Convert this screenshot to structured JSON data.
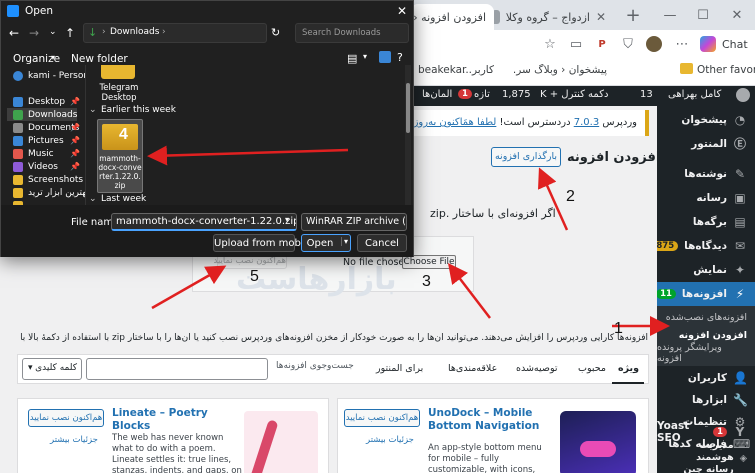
{
  "browser": {
    "tabs": [
      {
        "label": "افزودن افزونه ‹ ک"
      },
      {
        "label": "ازدواج – گروه وکلا"
      }
    ],
    "address_icons": [
      "star-icon",
      "reader-icon",
      "share-icon",
      "extension-icon",
      "wallet-icon",
      "favorites-icon",
      "copilot-icon"
    ],
    "chat_label": "Chat",
    "bookmarks": {
      "other_favorites": "Other favorites",
      "items": [
        "پیشخوان ‹ وبلاگ سر...",
        "کاربر...",
        "beakekar"
      ]
    }
  },
  "adminbar": {
    "site": "کامل بهراهی",
    "updates": "13",
    "dashboard_control": "دکمه کنترل + K",
    "comments": "1,875",
    "new": "تازه",
    "new_count": "1",
    "elementor": "المان‌ها"
  },
  "sidebar": {
    "items": [
      {
        "label": "پیشخوان",
        "icon": "dashboard-icon"
      },
      {
        "label": "المنتور",
        "icon": "elementor-icon"
      },
      {
        "label": "نوشته‌ها",
        "icon": "posts-icon"
      },
      {
        "label": "رسانه",
        "icon": "media-icon"
      },
      {
        "label": "برگه‌ها",
        "icon": "pages-icon"
      },
      {
        "label": "دیدگاه‌ها",
        "icon": "comments-icon",
        "badge": "1,875"
      },
      {
        "label": "نمایش",
        "icon": "appearance-icon"
      },
      {
        "label": "افزونه‌ها",
        "icon": "plugins-icon",
        "badge": "11"
      },
      {
        "label": "افزونه‌های نصب‌شده"
      },
      {
        "label": "افزودن افزونه"
      },
      {
        "label": "ویرایشگر پرونده افزونه"
      },
      {
        "label": "کاربران",
        "icon": "users-icon"
      },
      {
        "label": "ابزارها",
        "icon": "tools-icon"
      },
      {
        "label": "تنظیمات",
        "icon": "settings-icon"
      },
      {
        "label": "فاصله کدها",
        "icon": "snippets-icon"
      },
      {
        "label": "Yoast SEO",
        "icon": "yoast-icon",
        "badge": "1"
      },
      {
        "label": "مدیریت هوشمند رسانه چین",
        "icon": "smart-icon"
      }
    ]
  },
  "main": {
    "notice_prefix": "وردپرس",
    "notice_version": "7.0.3",
    "notice_mid": " دردسترس است! ",
    "notice_link": "لطفا همَاکنون به‌روزرسانی نمایید.",
    "page_title": "افزودن افزونه",
    "upload_button": "بارگذاری افزونه",
    "upload_hint": "اگر افزونه‌ای با ساختار .zip",
    "no_file": "No file chosen",
    "choose_file": "Choose File",
    "install_now": "هم‌اکنون نصب نمایید",
    "watermark": "بازارهاست",
    "description": "افزونه‌ها کارایی وردپرس را افزایش می‌دهند. می‌توانید آن‌ها را به صورت خودکار از مخزن افزونه‌های وردپرس نصب کنید یا آن‌ها را با ساختار zip با استفاده از دکمهٔ بالا بارگذاری کنید.",
    "description_link": "مخزن افزونه‌های وردپرس",
    "filter_tabs": [
      "ویژه",
      "محبوب",
      "توصیه‌شده",
      "علاقه‌مندی‌ها"
    ],
    "for_elementor": "برای المنتور",
    "search_type": "کلمه کلیدی",
    "search_placeholder": "جست‌وجوی افزونه‌ها",
    "cards": [
      {
        "title": "UnoDock – Mobile Bottom Navigation",
        "install": "هم‌اکنون نصب نمایید",
        "details": "جزئیات بیشتر",
        "desc": "An app-style bottom menu for mobile – fully customizable, with icons, colors, and links you control."
      },
      {
        "title": "Lineate – Poetry Blocks",
        "install": "هم‌اکنون نصب نمایید",
        "details": "جزئیات بیشتر",
        "desc": "The web has never known what to do with a poem. Lineate settles it: true lines, stanzas, indents, and gaps, on every screen. Built by a"
      }
    ]
  },
  "dialog": {
    "title": "Open",
    "path": "Downloads",
    "search_placeholder": "Search Downloads",
    "organize": "Organize",
    "new_folder": "New folder",
    "sidebar": [
      {
        "label": "kami - Personal",
        "icon": "onedrive-icon",
        "color": "#3a86d6"
      },
      {
        "label": "Desktop",
        "icon": "desktop-icon",
        "color": "#3a86d6"
      },
      {
        "label": "Downloads",
        "icon": "downloads-icon",
        "color": "#3fa34d"
      },
      {
        "label": "Documents",
        "icon": "documents-icon",
        "color": "#8a8a8a"
      },
      {
        "label": "Pictures",
        "icon": "pictures-icon",
        "color": "#3a86d6"
      },
      {
        "label": "Music",
        "icon": "music-icon",
        "color": "#e2574c"
      },
      {
        "label": "Videos",
        "icon": "videos-icon",
        "color": "#8e5bd8"
      },
      {
        "label": "Screenshots",
        "icon": "folder-icon",
        "color": "#e8b730"
      },
      {
        "label": "بهترین ابزار ترید",
        "icon": "folder-icon",
        "color": "#e8b730"
      },
      {
        "label": "...",
        "icon": "folder-icon",
        "color": "#e8b730"
      }
    ],
    "telegram_folder": "Telegram Desktop",
    "group_earlier": "Earlier this week",
    "selected_file": "mammoth-docx-converter.1.22.0.zip",
    "group_last": "Last week",
    "filename_label": "File name:",
    "filename_value": "mammoth-docx-converter-1.22.0.zip",
    "filetype": "WinRAR ZIP archive (*.z",
    "upload_mobile": "Upload from mobile",
    "open": "Open",
    "cancel": "Cancel"
  },
  "annotations": [
    "1",
    "2",
    "3",
    "4",
    "5"
  ],
  "colors": {
    "accent": "#2271b1",
    "admin_dark": "#1d2327",
    "arrow": "#e02020",
    "dialog_bg": "#202020"
  }
}
